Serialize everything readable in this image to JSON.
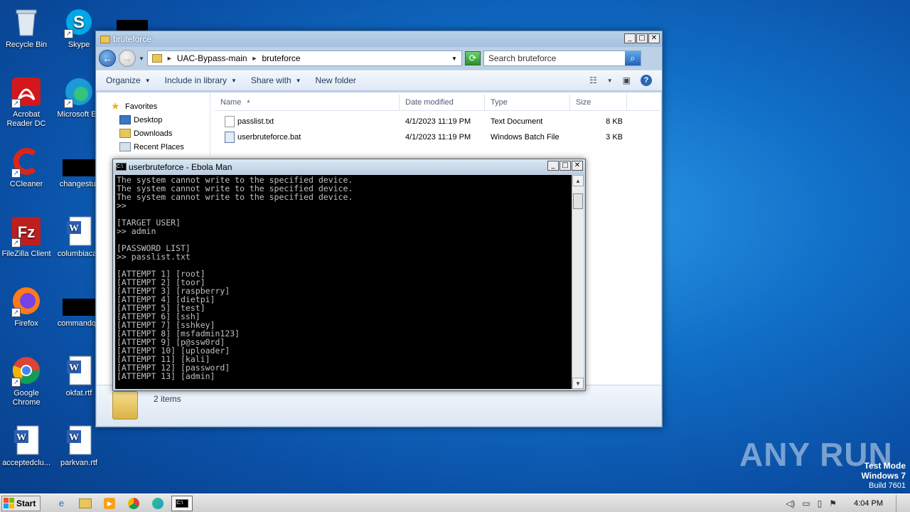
{
  "desktop": {
    "icons": [
      {
        "label": "Recycle Bin",
        "icon": "recycle-bin-icon"
      },
      {
        "label": "Skype",
        "icon": "skype-icon"
      },
      {
        "label": "Acrobat Reader DC",
        "icon": "acrobat-icon"
      },
      {
        "label": "Microsoft Ed",
        "icon": "edge-icon"
      },
      {
        "label": "CCleaner",
        "icon": "ccleaner-icon"
      },
      {
        "label": "changestur",
        "icon": "blank-icon"
      },
      {
        "label": "FileZilla Client",
        "icon": "filezilla-icon"
      },
      {
        "label": "columbiacali",
        "icon": "word-doc-icon"
      },
      {
        "label": "Firefox",
        "icon": "firefox-icon"
      },
      {
        "label": "commandqu",
        "icon": "blank-icon"
      },
      {
        "label": "Google Chrome",
        "icon": "chrome-icon"
      },
      {
        "label": "okfat.rtf",
        "icon": "word-doc-icon"
      },
      {
        "label": "acceptedclu...",
        "icon": "word-doc-icon"
      },
      {
        "label": "parkvan.rtf",
        "icon": "word-doc-icon"
      }
    ]
  },
  "explorer": {
    "title": "bruteforce",
    "breadcrumb": [
      "UAC-Bypass-main",
      "bruteforce"
    ],
    "search_placeholder": "Search bruteforce",
    "toolbar": {
      "organize": "Organize",
      "include": "Include in library",
      "share": "Share with",
      "newfolder": "New folder"
    },
    "nav": {
      "favorites": "Favorites",
      "items": [
        "Desktop",
        "Downloads",
        "Recent Places"
      ]
    },
    "columns": [
      "Name",
      "Date modified",
      "Type",
      "Size"
    ],
    "files": [
      {
        "name": "passlist.txt",
        "date": "4/1/2023 11:19 PM",
        "type": "Text Document",
        "size": "8 KB"
      },
      {
        "name": "userbruteforce.bat",
        "date": "4/1/2023 11:19 PM",
        "type": "Windows Batch File",
        "size": "3 KB"
      }
    ],
    "status": "2 items"
  },
  "cmd": {
    "title": "userbruteforce - Ebola Man",
    "lines": [
      "The system cannot write to the specified device.",
      "The system cannot write to the specified device.",
      "The system cannot write to the specified device.",
      ">>",
      "",
      "[TARGET USER]",
      ">> admin",
      "",
      "[PASSWORD LIST]",
      ">> passlist.txt",
      "",
      "[ATTEMPT 1] [root]",
      "[ATTEMPT 2] [toor]",
      "[ATTEMPT 3] [raspberry]",
      "[ATTEMPT 4] [dietpi]",
      "[ATTEMPT 5] [test]",
      "[ATTEMPT 6] [ssh]",
      "[ATTEMPT 7] [sshkey]",
      "[ATTEMPT 8] [msfadmin123]",
      "[ATTEMPT 9] [p@ssw0rd]",
      "[ATTEMPT 10] [uploader]",
      "[ATTEMPT 11] [kali]",
      "[ATTEMPT 12] [password]",
      "[ATTEMPT 13] [admin]"
    ]
  },
  "taskbar": {
    "start": "Start",
    "clock": "4:04 PM"
  },
  "watermark": "ANY RUN",
  "testmode": {
    "line1": "Test Mode",
    "line2": "Windows 7",
    "line3": "Build 7601"
  }
}
